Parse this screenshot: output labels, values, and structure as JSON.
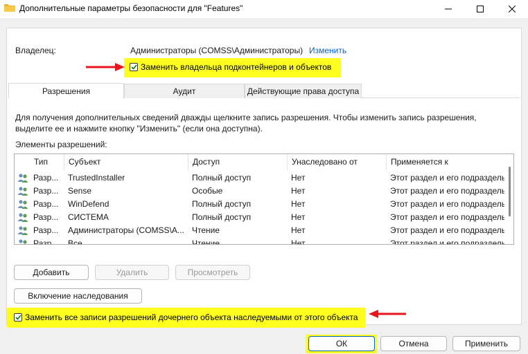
{
  "window": {
    "title": "Дополнительные параметры безопасности  для \"Features\""
  },
  "owner": {
    "label": "Владелец:",
    "value": "Администраторы (COMSS\\Администраторы)",
    "change_link": "Изменить",
    "replace_checkbox_label": "Заменить владельца подконтейнеров и объектов",
    "replace_checked": true
  },
  "tabs": [
    {
      "label": "Разрешения",
      "active": true
    },
    {
      "label": "Аудит",
      "active": false
    },
    {
      "label": "Действующие права доступа",
      "active": false
    }
  ],
  "info_text": "Для получения дополнительных сведений дважды щелкните запись разрешения. Чтобы изменить запись разрешения, выделите ее и нажмите кнопку \"Изменить\" (если она доступна).",
  "elements_label": "Элементы разрешений:",
  "table": {
    "columns": [
      "Тип",
      "Субъект",
      "Доступ",
      "Унаследовано от",
      "Применяется к"
    ],
    "rows": [
      [
        "Разр...",
        "TrustedInstaller",
        "Полный доступ",
        "Нет",
        "Этот раздел и его подраздель"
      ],
      [
        "Разр...",
        "Sense",
        "Особые",
        "Нет",
        "Этот раздел и его подраздель"
      ],
      [
        "Разр...",
        "WinDefend",
        "Полный доступ",
        "Нет",
        "Этот раздел и его подраздель"
      ],
      [
        "Разр...",
        "СИСТЕМА",
        "Полный доступ",
        "Нет",
        "Этот раздел и его подраздель"
      ],
      [
        "Разр...",
        "Администраторы (COMSS\\А...",
        "Чтение",
        "Нет",
        "Этот раздел и его подраздель"
      ],
      [
        "Разр...",
        "Все",
        "Чтение",
        "Нет",
        "Этот раздел и его подраздель"
      ]
    ]
  },
  "buttons": {
    "add": "Добавить",
    "delete": "Удалить",
    "view": "Просмотреть",
    "inheritance": "Включение наследования",
    "ok": "ОК",
    "cancel": "Отмена",
    "apply": "Применить"
  },
  "replace_child_checkbox": {
    "label": "Заменить все записи разрешений дочернего объекта наследуемыми от этого объекта",
    "checked": true
  },
  "colors": {
    "highlight": "#ffff1f",
    "arrow": "#e8141c",
    "link": "#0066cc",
    "check_fill": "#0f7b0f"
  }
}
